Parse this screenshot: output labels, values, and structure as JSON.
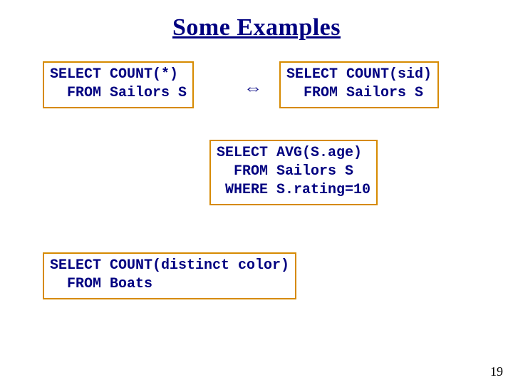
{
  "title": "Some Examples",
  "arrow_glyph": "⇔",
  "page_number": "19",
  "boxes": {
    "count_star": "SELECT COUNT(*)\n  FROM Sailors S",
    "count_sid": "SELECT COUNT(sid)\n  FROM Sailors S",
    "avg_age": "SELECT AVG(S.age)\n  FROM Sailors S\n WHERE S.rating=10",
    "count_distinct_color": "SELECT COUNT(distinct color)\n  FROM Boats"
  }
}
